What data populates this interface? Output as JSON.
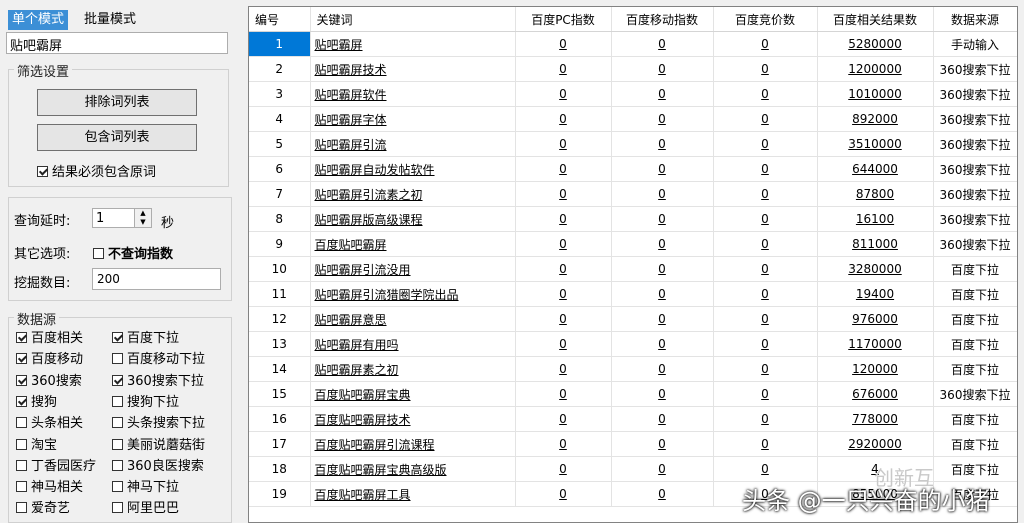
{
  "tabs": {
    "single": "单个模式",
    "batch": "批量模式"
  },
  "keyword_input": "贴吧霸屏",
  "filter": {
    "title": "筛选设置",
    "exclude_btn": "排除词列表",
    "include_btn": "包含词列表",
    "must_contain": "结果必须包含原词",
    "must_contain_checked": true
  },
  "query": {
    "delay_label": "查询延时:",
    "delay_value": "1",
    "delay_unit": "秒",
    "other_label": "其它选项:",
    "no_index_label": "不查询指数",
    "no_index_checked": false,
    "mine_label": "挖掘数目:",
    "mine_value": "200"
  },
  "sources": {
    "title": "数据源",
    "items": [
      {
        "label": "百度相关",
        "checked": true
      },
      {
        "label": "百度下拉",
        "checked": true
      },
      {
        "label": "百度移动",
        "checked": true
      },
      {
        "label": "百度移动下拉",
        "checked": false
      },
      {
        "label": "360搜索",
        "checked": true
      },
      {
        "label": "360搜索下拉",
        "checked": true
      },
      {
        "label": "搜狗",
        "checked": true
      },
      {
        "label": "搜狗下拉",
        "checked": false
      },
      {
        "label": "头条相关",
        "checked": false
      },
      {
        "label": "头条搜索下拉",
        "checked": false
      },
      {
        "label": "淘宝",
        "checked": false
      },
      {
        "label": "美丽说蘑菇街",
        "checked": false
      },
      {
        "label": "丁香园医疗",
        "checked": false
      },
      {
        "label": "360良医搜索",
        "checked": false
      },
      {
        "label": "神马相关",
        "checked": false
      },
      {
        "label": "神马下拉",
        "checked": false
      },
      {
        "label": "爱奇艺",
        "checked": false
      },
      {
        "label": "阿里巴巴",
        "checked": false
      }
    ]
  },
  "table": {
    "headers": [
      "编号",
      "关键词",
      "百度PC指数",
      "百度移动指数",
      "百度竞价数",
      "百度相关结果数",
      "数据来源"
    ],
    "rows": [
      [
        "1",
        "贴吧霸屏",
        "0",
        "0",
        "0",
        "5280000",
        "手动输入"
      ],
      [
        "2",
        "贴吧霸屏技术",
        "0",
        "0",
        "0",
        "1200000",
        "360搜索下拉"
      ],
      [
        "3",
        "贴吧霸屏软件",
        "0",
        "0",
        "0",
        "1010000",
        "360搜索下拉"
      ],
      [
        "4",
        "贴吧霸屏字体",
        "0",
        "0",
        "0",
        "892000",
        "360搜索下拉"
      ],
      [
        "5",
        "贴吧霸屏引流",
        "0",
        "0",
        "0",
        "3510000",
        "360搜索下拉"
      ],
      [
        "6",
        "贴吧霸屏自动发帖软件",
        "0",
        "0",
        "0",
        "644000",
        "360搜索下拉"
      ],
      [
        "7",
        "贴吧霸屏引流素之初",
        "0",
        "0",
        "0",
        "87800",
        "360搜索下拉"
      ],
      [
        "8",
        "贴吧霸屏版高级课程",
        "0",
        "0",
        "0",
        "16100",
        "360搜索下拉"
      ],
      [
        "9",
        "百度贴吧霸屏",
        "0",
        "0",
        "0",
        "811000",
        "360搜索下拉"
      ],
      [
        "10",
        "贴吧霸屏引流没用",
        "0",
        "0",
        "0",
        "3280000",
        "百度下拉"
      ],
      [
        "11",
        "贴吧霸屏引流猎圈学院出品",
        "0",
        "0",
        "0",
        "19400",
        "百度下拉"
      ],
      [
        "12",
        "贴吧霸屏意思",
        "0",
        "0",
        "0",
        "976000",
        "百度下拉"
      ],
      [
        "13",
        "贴吧霸屏有用吗",
        "0",
        "0",
        "0",
        "1170000",
        "百度下拉"
      ],
      [
        "14",
        "贴吧霸屏素之初",
        "0",
        "0",
        "0",
        "120000",
        "百度下拉"
      ],
      [
        "15",
        "百度贴吧霸屏宝典",
        "0",
        "0",
        "0",
        "676000",
        "360搜索下拉"
      ],
      [
        "16",
        "百度贴吧霸屏技术",
        "0",
        "0",
        "0",
        "778000",
        "百度下拉"
      ],
      [
        "17",
        "百度贴吧霸屏引流课程",
        "0",
        "0",
        "0",
        "2920000",
        "百度下拉"
      ],
      [
        "18",
        "百度贴吧霸屏宝典高级版",
        "0",
        "0",
        "0",
        "4",
        "百度下拉"
      ],
      [
        "19",
        "百度贴吧霸屏工具",
        "0",
        "0",
        "0",
        "855000",
        "百度下拉"
      ]
    ]
  },
  "watermark": {
    "brand": "创新互",
    "author": "头条 @一只兴奋的小猪"
  }
}
